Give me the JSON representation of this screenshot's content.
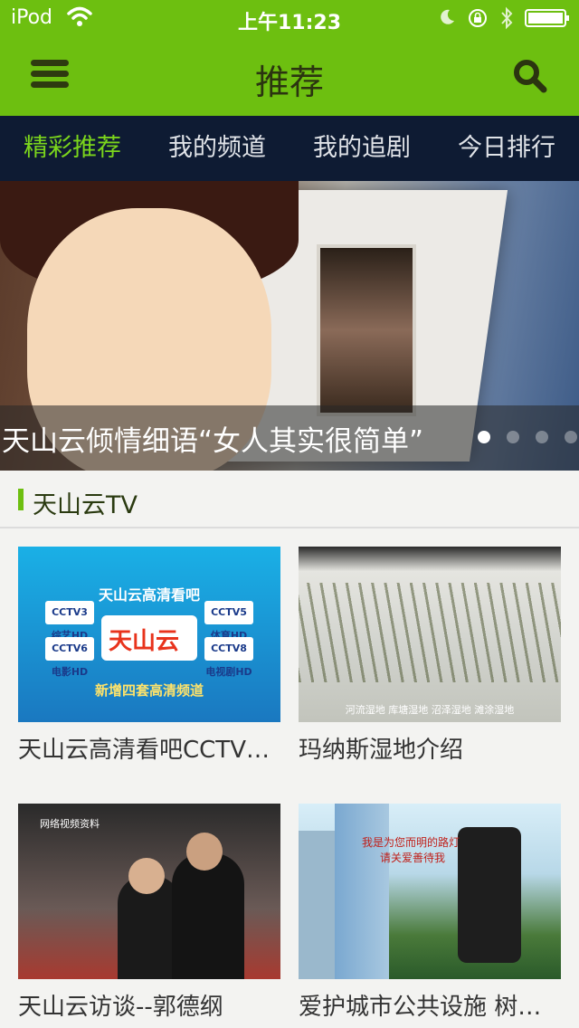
{
  "status_bar": {
    "carrier": "iPod",
    "time": "上午11:23",
    "icons": [
      "wifi-icon",
      "moon-icon",
      "orientation-lock-icon",
      "bluetooth-icon",
      "battery-icon"
    ]
  },
  "header": {
    "title": "推荐",
    "menu_icon": "hamburger-menu-icon",
    "search_icon": "search-icon"
  },
  "tabs": [
    {
      "label": "精彩推荐",
      "active": true
    },
    {
      "label": "我的频道",
      "active": false
    },
    {
      "label": "我的追剧",
      "active": false
    },
    {
      "label": "今日排行",
      "active": false
    }
  ],
  "banner": {
    "caption": "天山云倾情细语“女人其实很简单”",
    "pages": 4,
    "current_page": 1
  },
  "section": {
    "title": "天山云TV"
  },
  "videos": [
    {
      "title": "天山云高清看吧CCTV高清频道",
      "thumb_text": {
        "heading": "天山云高清看吧",
        "logo": "天山云",
        "footer": "新增四套高清频道",
        "channels": [
          "CCTV3 综艺HD",
          "CCTV5 体育HD",
          "CCTV6 电影HD",
          "CCTV8 电视剧HD"
        ]
      }
    },
    {
      "title": "玛纳斯湿地介绍",
      "thumb_text": {
        "subtitle": "河流湿地  库塘湿地  沼泽湿地  滩涂湿地"
      }
    },
    {
      "title": "天山云访谈--郭德纲",
      "thumb_text": {
        "label": "网络视频资料"
      }
    },
    {
      "title": "爱护城市公共设施 树立文明城市形象",
      "thumb_text": {
        "line1": "我是为您而明的路灯",
        "line2": "请关爱善待我"
      }
    }
  ],
  "colors": {
    "header_green": "#6dbf10",
    "tab_bar_navy": "#0e1b33",
    "active_tab": "#7bd51c"
  }
}
